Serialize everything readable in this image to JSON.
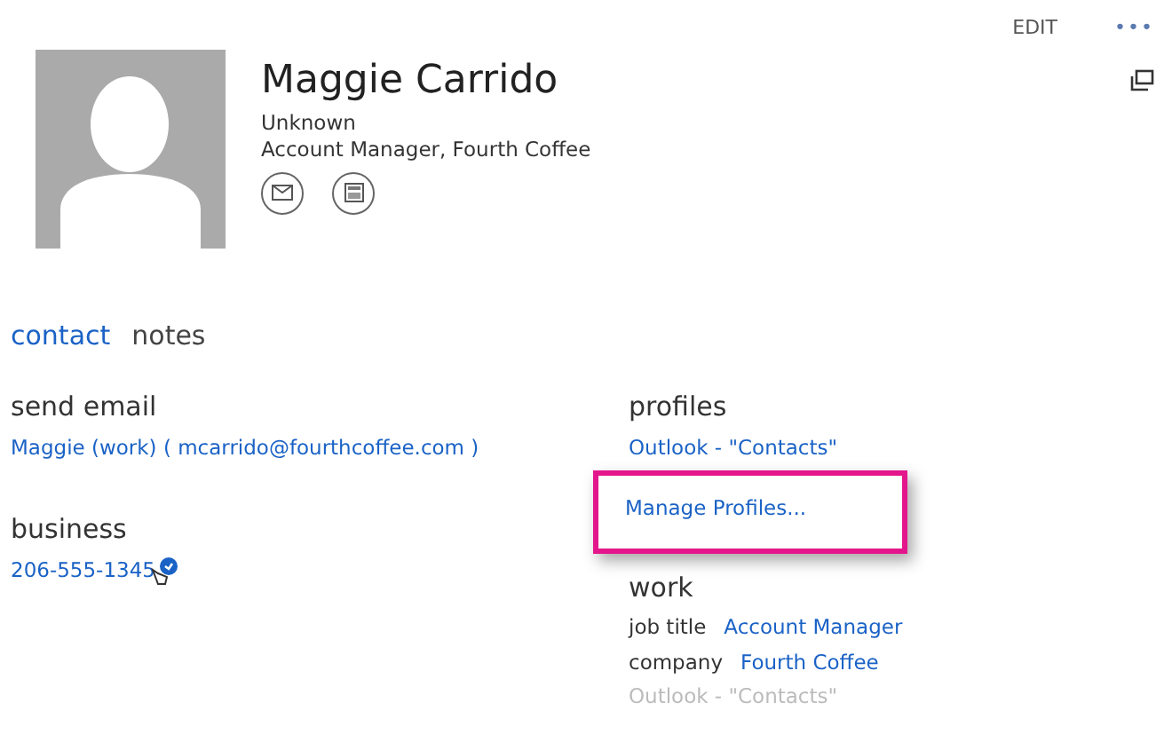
{
  "header_actions": {
    "edit": "EDIT",
    "more": "•••"
  },
  "contact": {
    "name": "Maggie Carrido",
    "status": "Unknown",
    "title": "Account Manager, Fourth Coffee"
  },
  "tabs": [
    {
      "label": "contact",
      "selected": true
    },
    {
      "label": "notes",
      "selected": false
    }
  ],
  "send_email": {
    "heading": "send email",
    "value": "Maggie (work) ( mcarrido@fourthcoffee.com )"
  },
  "business": {
    "heading": "business",
    "value": "206-555-1345"
  },
  "profiles": {
    "heading": "profiles",
    "source": "Outlook - \"Contacts\"",
    "manage": "Manage Profiles...",
    "highlighted": true
  },
  "work": {
    "heading": "work",
    "fields": [
      {
        "label": "job title",
        "value": "Account Manager"
      },
      {
        "label": "company",
        "value": "Fourth Coffee"
      }
    ],
    "source": "Outlook - \"Contacts\""
  }
}
